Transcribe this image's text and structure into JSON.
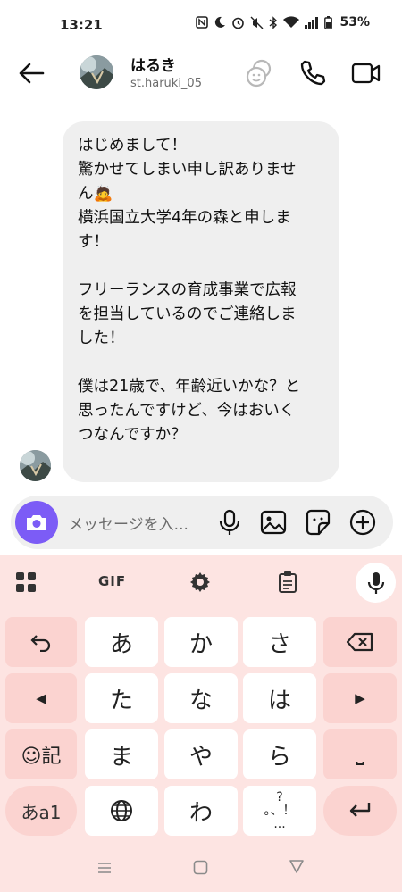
{
  "status_bar": {
    "time": "13:21",
    "battery": "53%"
  },
  "header": {
    "name": "はるき",
    "username": "st.haruki_05"
  },
  "message": {
    "text": "はじめまして！\n驚かせてしまい申し訳ありませ\nん🙇\n横浜国立大学4年の森と申しま\nす！\n\nフリーランスの育成事業で広報\nを担当しているのでご連絡しま\nした！\n\n僕は21歳で、年齢近いかな？と\n思ったんですけど、今はおいく\nつなんですか？"
  },
  "composer": {
    "placeholder": "メッセージを入..."
  },
  "keyboard": {
    "toolbar": {
      "gif": "GIF"
    },
    "rows": [
      [
        "↶",
        "あ",
        "か",
        "さ",
        "⌫"
      ],
      [
        "◀",
        "た",
        "な",
        "は",
        "▶"
      ],
      [
        "☺記",
        "ま",
        "や",
        "ら",
        "⎵"
      ],
      [
        "あa1",
        "⊕",
        "わ",
        "゛゜",
        "↵"
      ]
    ],
    "punct_key": {
      "top": "?",
      "bottom": "。、！",
      "small": "..."
    }
  },
  "colors": {
    "accent": "#7c5cf6",
    "keyboard_bg": "#fde4e2",
    "key_pink": "#fbd3d0",
    "bubble": "#efefef"
  }
}
